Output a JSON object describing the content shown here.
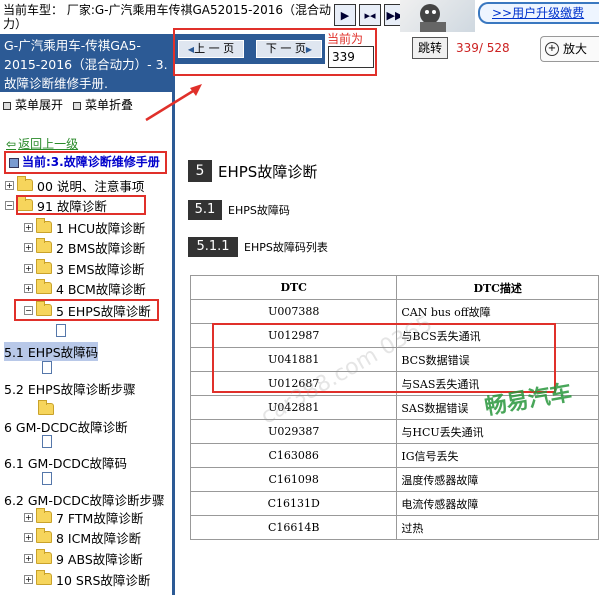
{
  "header": {
    "car_label": "当前车型： 厂家:G-广汽乘用车传祺GA52015-2016（混合动力）",
    "upgrade_link": ">>用户升级缴费"
  },
  "sidebar": {
    "title": "G-广汽乘用车-传祺GA5-2015-2016（混合动力）- 3.故障诊断维修手册.",
    "expand": "菜单展开",
    "collapse": "菜单折叠",
    "back": "返回上一级",
    "current": "当前:3.故障诊断维修手册",
    "tree": [
      "00 说明、注意事项",
      "91 故障诊断",
      "1 HCU故障诊断",
      "2 BMS故障诊断",
      "3 EMS故障诊断",
      "4 BCM故障诊断",
      "5 EHPS故障诊断",
      "5.1 EHPS故障码",
      "5.2 EHPS故障诊断步骤",
      "6 GM-DCDC故障诊断",
      "6.1 GM-DCDC故障码",
      "6.2 GM-DCDC故障诊断步骤",
      "7 FTM故障诊断",
      "8 ICM故障诊断",
      "9 ABS故障诊断",
      "10 SRS故障诊断"
    ]
  },
  "toolbar": {
    "prev": "上 一 页",
    "next": "下 一 页",
    "current_label": "当前为",
    "page_value": "339",
    "jump": "跳转",
    "page_count": "339/ 528",
    "zoom": "放大"
  },
  "doc": {
    "h5_num": "5",
    "h5_title": "EHPS故障诊断",
    "h51_num": "5.1",
    "h51_title": "EHPS故障码",
    "h511_num": "5.1.1",
    "h511_title": "EHPS故障码列表",
    "table": {
      "headers": [
        "DTC",
        "DTC描述"
      ],
      "rows": [
        [
          "U007388",
          "CAN bus off故障"
        ],
        [
          "U012987",
          "与BCS丢失通讯"
        ],
        [
          "U041881",
          "BCS数据错误"
        ],
        [
          "U012687",
          "与SAS丢失通讯"
        ],
        [
          "U042881",
          "SAS数据错误"
        ],
        [
          "U029387",
          "与HCU丢失通讯"
        ],
        [
          "C163086",
          "IG信号丢失"
        ],
        [
          "C161098",
          "温度传感器故障"
        ],
        [
          "C16131D",
          "电流传感器故障"
        ],
        [
          "C16614B",
          "过热"
        ]
      ]
    }
  },
  "watermarks": {
    "gray": "car388.com 0365",
    "green": "畅易汽车"
  }
}
